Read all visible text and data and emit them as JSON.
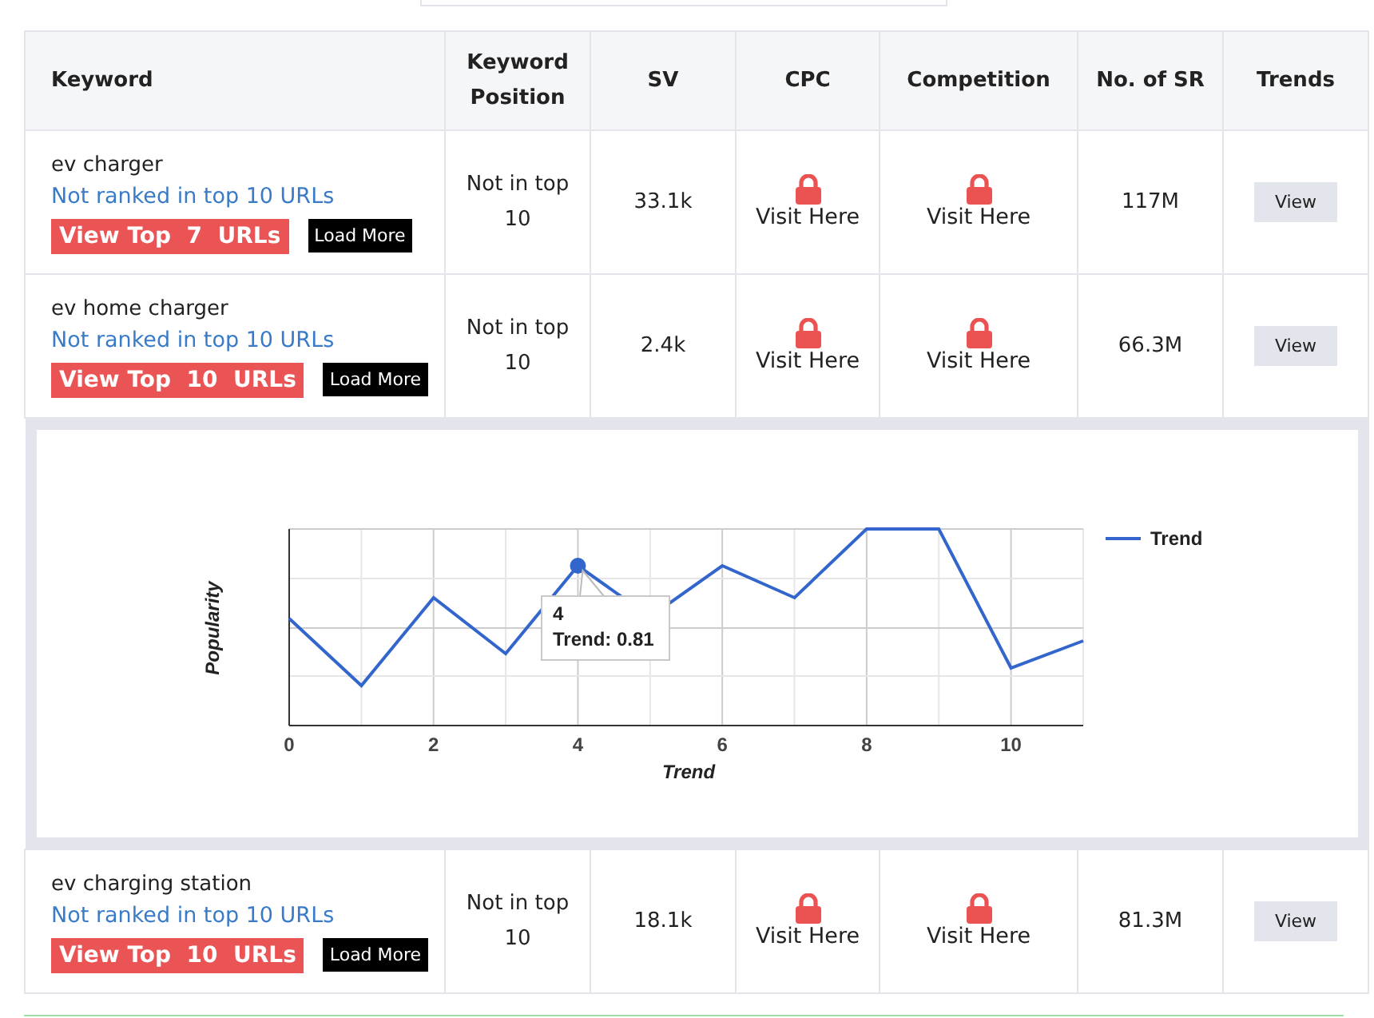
{
  "table": {
    "columns": [
      "Keyword",
      "Keyword Position",
      "SV",
      "CPC",
      "Competition",
      "No. of SR",
      "Trends"
    ],
    "rows": [
      {
        "keyword": "ev charger",
        "rank_note": "Not ranked in top 10 URLs",
        "top_button": "View Top  7  URLs",
        "more_button": "Load More",
        "position": "Not in top 10",
        "sv": "33.1k",
        "cpc": "Visit Here",
        "competition": "Visit Here",
        "sr": "117M",
        "trends_button": "View"
      },
      {
        "keyword": "ev home charger",
        "rank_note": "Not ranked in top 10 URLs",
        "top_button": "View Top  10  URLs",
        "more_button": "Load More",
        "position": "Not in top 10",
        "sv": "2.4k",
        "cpc": "Visit Here",
        "competition": "Visit Here",
        "sr": "66.3M",
        "trends_button": "View",
        "trend_chart": {
          "ylabel": "Popularity",
          "xlabel": "Trend",
          "xticks": [
            "0",
            "2",
            "4",
            "6",
            "8",
            "10"
          ],
          "legend": "Trend",
          "tooltip": {
            "title": "4",
            "text": "Trend: 0.81"
          }
        }
      },
      {
        "keyword": "ev charging station",
        "rank_note": "Not ranked in top 10 URLs",
        "top_button": "View Top  10  URLs",
        "more_button": "Load More",
        "position": "Not in top 10",
        "sv": "18.1k",
        "cpc": "Visit Here",
        "competition": "Visit Here",
        "sr": "81.3M",
        "trends_button": "View"
      }
    ]
  }
}
